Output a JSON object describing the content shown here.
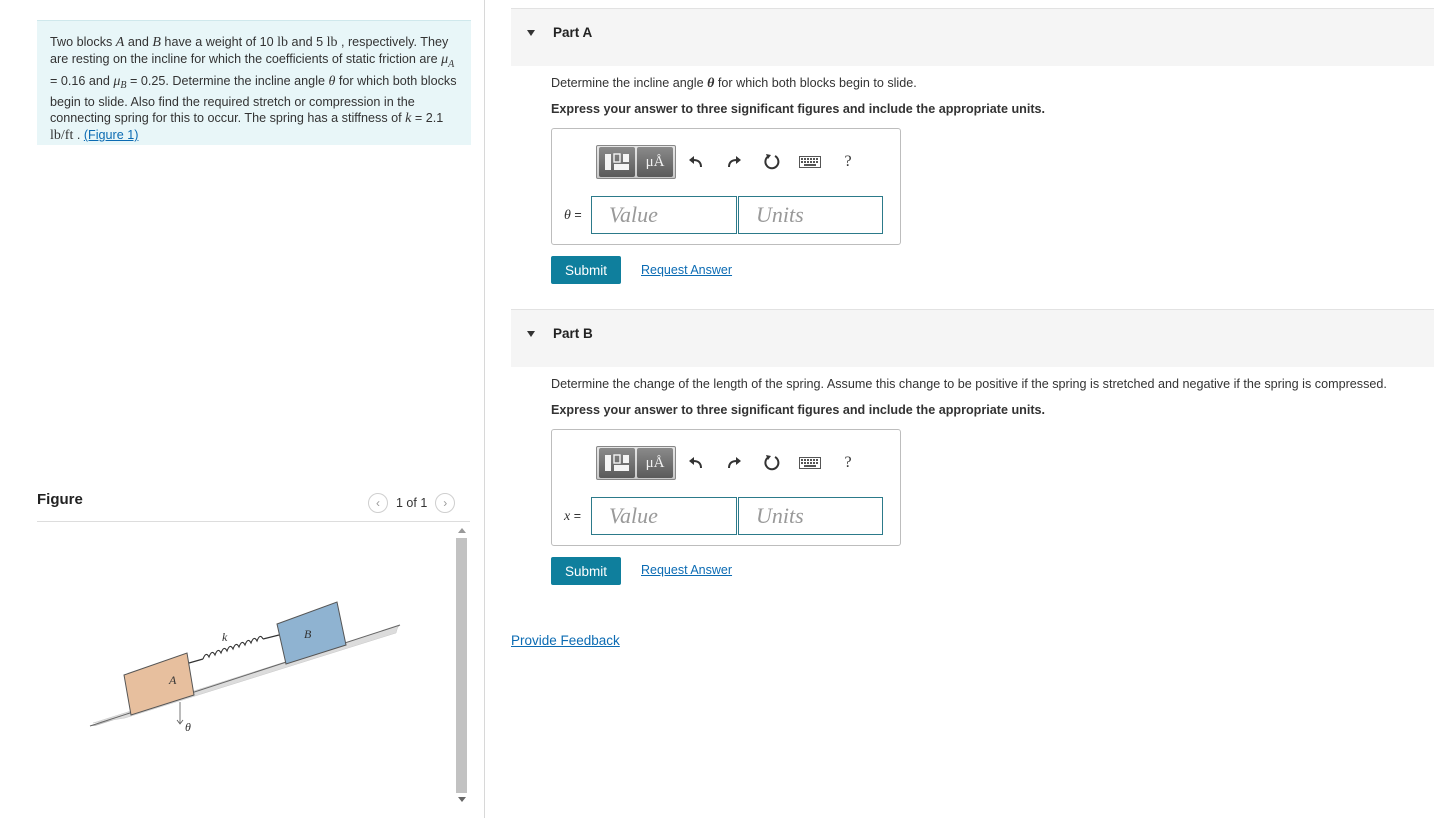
{
  "problem": {
    "t1": "Two blocks ",
    "varA": "A",
    "t2": " and ",
    "varB": "B",
    "t3": " have a weight of 10 ",
    "u1": "lb",
    "t4": " and 5 ",
    "u2": "lb",
    "t5": " , respectively. They are resting on the incline for which the coefficients of static friction are ",
    "muA": "μ",
    "subA": "A",
    "t6": " = 0.16 and ",
    "muB": "μ",
    "subB": "B",
    "t7": " = 0.25. Determine the incline angle ",
    "theta": "θ",
    "t8": " for which both blocks begin to slide. Also find the required stretch or compression in the connecting spring for this to occur. The spring has a stiffness of ",
    "k": "k",
    "t9": " = 2.1 ",
    "u3": "lb/ft",
    "t10": " . ",
    "figure_link": "(Figure 1)"
  },
  "figure": {
    "title": "Figure",
    "pager": "1 of 1",
    "prev_icon": "chevron-left-icon",
    "next_icon": "chevron-right-icon",
    "labels": {
      "a": "A",
      "b": "B",
      "k": "k",
      "theta": "θ"
    },
    "colors": {
      "block_a": "#e7bf9e",
      "block_b": "#8fb3d1",
      "incline": "#dcdcdc"
    }
  },
  "parts": [
    {
      "title": "Part A",
      "question_pre": "Determine the incline angle ",
      "question_var": "θ",
      "question_post": " for which both blocks begin to slide.",
      "instruction": "Express your answer to three significant figures and include the appropriate units.",
      "var_label": "θ",
      "var_eq": " =",
      "value_placeholder": "Value",
      "units_placeholder": "Units",
      "submit": "Submit",
      "request": "Request Answer"
    },
    {
      "title": "Part B",
      "question_pre": "Determine the change of the length of the spring. Assume this change to be positive if the spring is stretched and negative if the spring is compressed.",
      "question_var": "",
      "question_post": "",
      "instruction": "Express your answer to three significant figures and include the appropriate units.",
      "var_label": "x",
      "var_eq": " =",
      "value_placeholder": "Value",
      "units_placeholder": "Units",
      "submit": "Submit",
      "request": "Request Answer"
    }
  ],
  "toolbar": {
    "units_label": "μÅ",
    "help_label": "?",
    "icons": [
      "templates-icon",
      "units-icon",
      "undo-icon",
      "redo-icon",
      "reset-icon",
      "keyboard-icon",
      "help-icon"
    ]
  },
  "feedback": "Provide Feedback",
  "colors": {
    "accent": "#0f7f9d",
    "link": "#0b6bb3",
    "problem_bg": "#e8f6f8"
  }
}
